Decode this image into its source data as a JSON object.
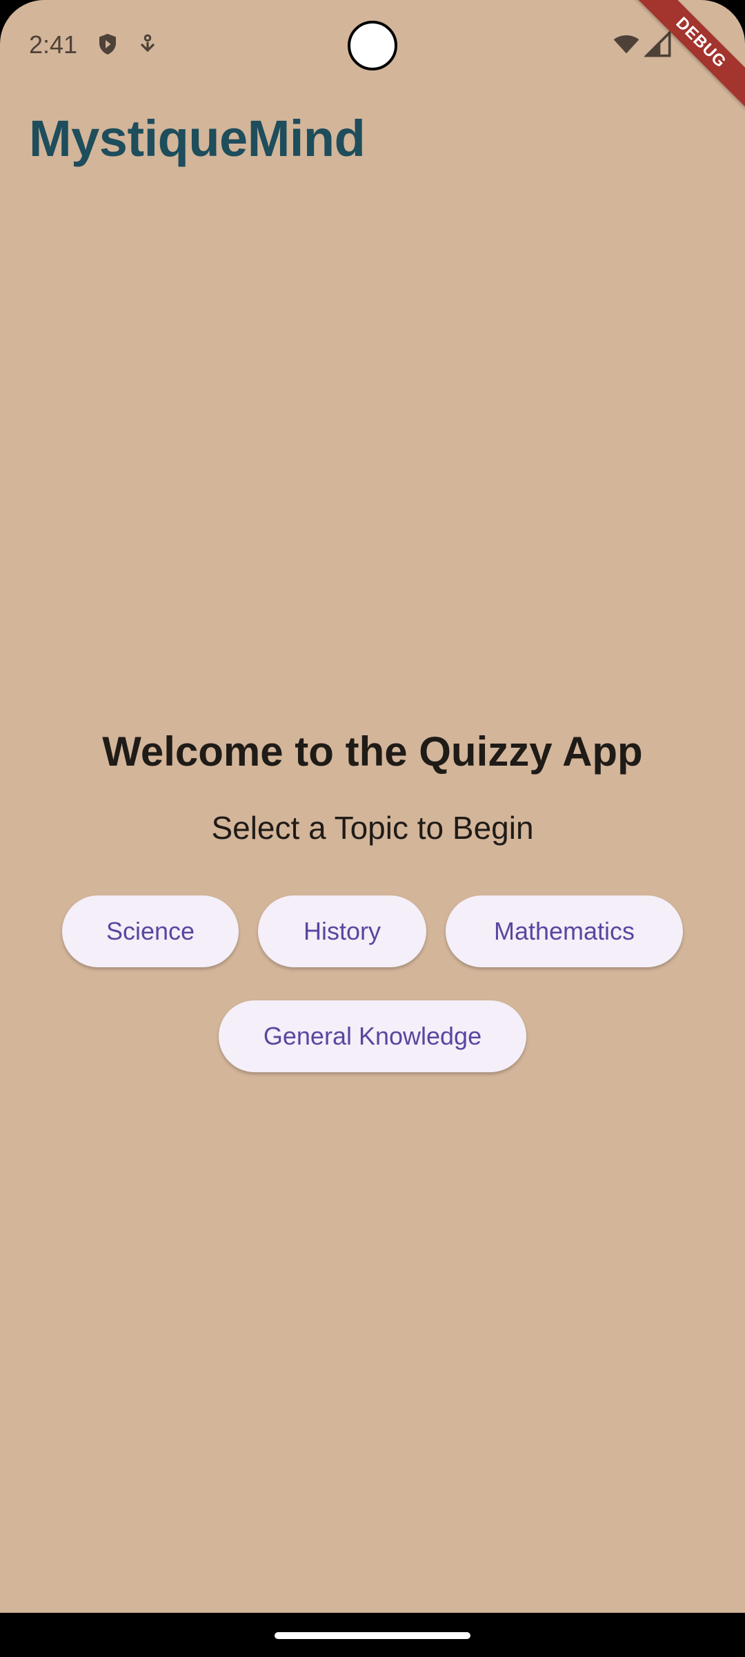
{
  "status_bar": {
    "time": "2:41",
    "icons_left": [
      "shield-play-icon",
      "download-notification-icon"
    ],
    "icons_right": [
      "wifi-icon",
      "cellular-signal-icon"
    ]
  },
  "debug_banner": "DEBUG",
  "app_bar": {
    "title": "MystiqueMind"
  },
  "main": {
    "heading": "Welcome to the Quizzy App",
    "subheading": "Select a Topic to Begin",
    "topics": [
      "Science",
      "History",
      "Mathematics",
      "General Knowledge"
    ]
  },
  "colors": {
    "background": "#D3B59A",
    "title": "#1E4D5C",
    "button_bg": "#F4EFF8",
    "button_text": "#5B45A0",
    "debug_ribbon": "#A3342E"
  }
}
